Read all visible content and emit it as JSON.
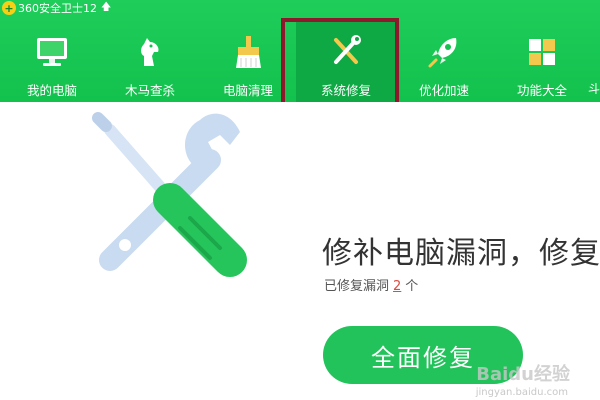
{
  "window": {
    "logo_glyph": "+",
    "title": "360安全卫士12",
    "update_arrow": "🡅"
  },
  "nav": {
    "active": "tab-system-repair",
    "items": [
      {
        "label": "我的电脑",
        "icon": "monitor-icon"
      },
      {
        "label": "木马查杀",
        "icon": "horse-icon"
      },
      {
        "label": "电脑清理",
        "icon": "broom-icon"
      },
      {
        "label": "系统修复",
        "icon": "wrench-screwdriver-icon"
      },
      {
        "label": "优化加速",
        "icon": "rocket-icon"
      },
      {
        "label": "功能大全",
        "icon": "grid-icon"
      }
    ],
    "edge_fragment": "斗"
  },
  "main": {
    "headline": "修补电脑漏洞，修复",
    "status_prefix": "已修复漏洞",
    "status_count": "2",
    "status_suffix": "个",
    "repair_button": "全面修复"
  },
  "watermark": {
    "text": "Baidu经验",
    "sub": "jingyan.baidu.com"
  },
  "colors": {
    "brand_green": "#12c24d",
    "button_green": "#22c35a",
    "highlight_border": "#8c1a2c",
    "count_red": "#e04a3f"
  }
}
